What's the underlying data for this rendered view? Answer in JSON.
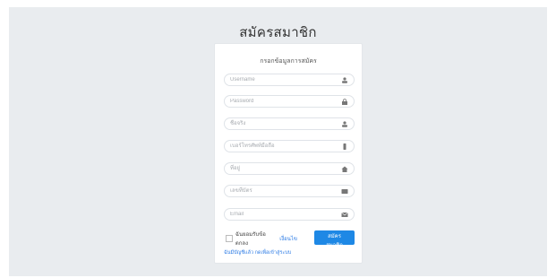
{
  "page": {
    "title": "สมัครสมาชิก"
  },
  "form": {
    "header": "กรอกข้อมูลการสมัคร",
    "fields": [
      {
        "placeholder": "Username",
        "icon": "user-icon"
      },
      {
        "placeholder": "Password",
        "icon": "lock-icon"
      },
      {
        "placeholder": "ชื่อจริง",
        "icon": "user-icon"
      },
      {
        "placeholder": "เบอร์โทรศัพท์มือถือ",
        "icon": "phone-icon"
      },
      {
        "placeholder": "ที่อยู่",
        "icon": "home-icon"
      },
      {
        "placeholder": "เลขที่บัตร",
        "icon": "id-card-icon"
      },
      {
        "placeholder": "Email",
        "icon": "email-icon"
      }
    ],
    "agree_text": "ฉันยอมรับข้อตกลง",
    "agree_link": "เงื่อนไข",
    "register_button": "สมัครสมาชิก",
    "login_link": "ฉันมีบัญชีแล้ว กดเพื่อเข้าสู่ระบบ"
  }
}
